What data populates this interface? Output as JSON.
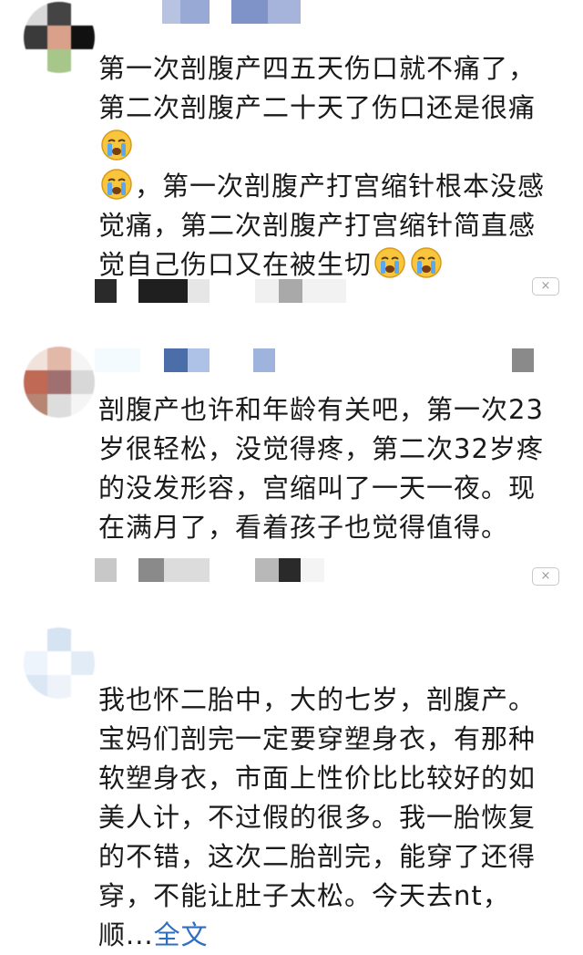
{
  "comments": [
    {
      "text_parts": [
        "第一次剖腹产四五天伤口就不痛了，第二次剖腹产二十天了伤口还是很痛",
        "，第一次剖腹产打宫缩针根本没感觉痛，第二次剖腹产打宫缩针简直感觉自己伤口又在被生切"
      ],
      "emoji": "crying-face-icon",
      "close_label": "×"
    },
    {
      "text": "剖腹产也许和年龄有关吧，第一次23岁很轻松，没觉得疼，第二次32岁疼的没发形容，宫缩叫了一天一夜。现在满月了，看着孩子也觉得值得。",
      "close_label": "×"
    },
    {
      "text": "我也怀二胎中，大的七岁，剖腹产。宝妈们剖完一定要穿塑身衣，有那种软塑身衣，市面上性价比比较好的如美人计，不过假的很多。我一胎恢复的不错，这次二胎剖完，能穿了还得穿，不能让肚子太松。今天去nt，顺...",
      "more_label": "全文"
    }
  ],
  "colors": {
    "text": "#1a1a1a",
    "link": "#2f6fbf",
    "close_border": "#c8c8c8"
  }
}
